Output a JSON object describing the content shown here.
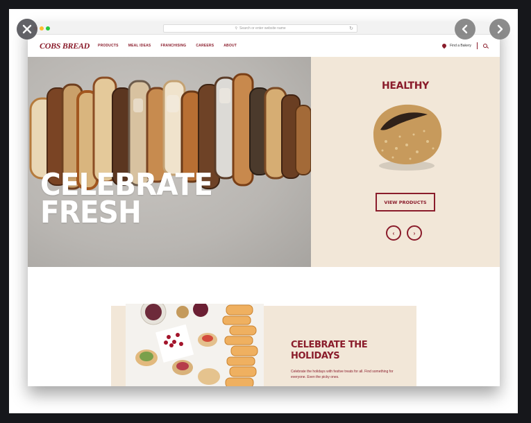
{
  "viewer": {
    "close_icon": "close-icon",
    "prev_icon": "chevron-left-icon",
    "next_icon": "chevron-right-icon"
  },
  "browser": {
    "url_placeholder": "Search or enter website name"
  },
  "site": {
    "logo": "COBS BREAD",
    "nav": [
      "PRODUCTS",
      "MEAL IDEAS",
      "FRANCHISING",
      "CAREERS",
      "ABOUT"
    ],
    "find_bakery": "Find a Bakery",
    "accent_color": "#8a1c2b",
    "cream_color": "#f2e7d8"
  },
  "hero": {
    "title_line1": "CELEBRATE",
    "title_line2": "FRESH",
    "category": "HEALTHY",
    "cta": "VIEW PRODUCTS"
  },
  "promo": {
    "title_line1": "CELEBRATE THE",
    "title_line2": "HOLIDAYS",
    "text": "Celebrate the holidays with festive treats for all. Find something for everyone. Even the picky ones."
  }
}
